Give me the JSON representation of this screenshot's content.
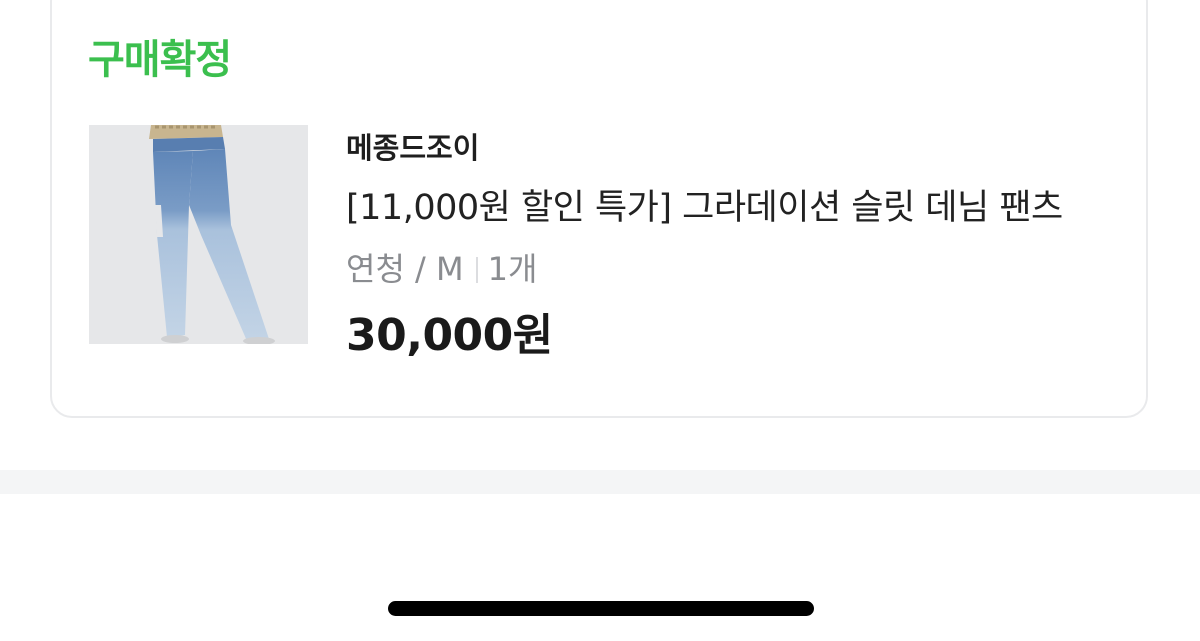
{
  "order": {
    "status": "구매확정",
    "status_color": "#3bbf4e",
    "item": {
      "shop_name": "메종드조이",
      "title": "[11,000원 할인 특가] 그라데이션 슬릿 데님 팬츠",
      "option_color_size": "연청 / M",
      "option_quantity": "1개",
      "price": "30,000원",
      "thumbnail_icon": "jeans-product-image"
    }
  }
}
